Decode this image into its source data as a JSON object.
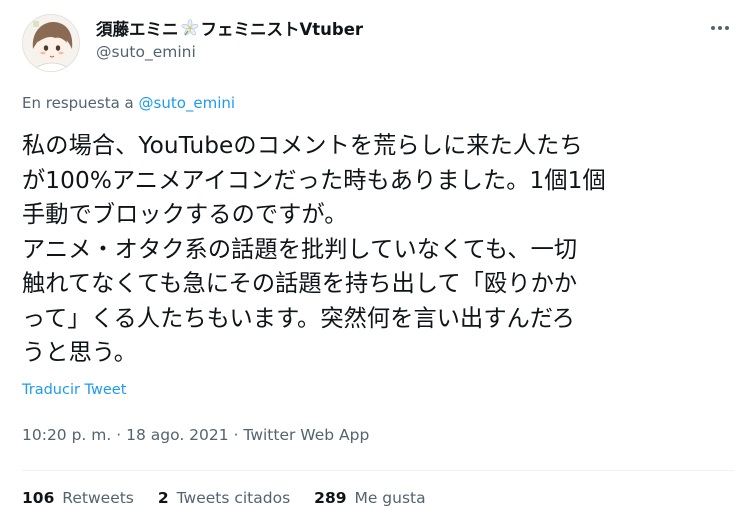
{
  "author": {
    "display_name_part1": "須藤エミニ",
    "flower_icon": "flower-emoji",
    "display_name_part2": "フェミニストVtuber",
    "handle": "@suto_emini",
    "avatar_icon": "anime-avatar"
  },
  "reply": {
    "prefix": "En respuesta a",
    "mention": "@suto_emini"
  },
  "tweet": {
    "lines": [
      "私の場合、YouTubeのコメントを荒らしに来た人たち",
      "が100%アニメアイコンだった時もありました。1個1個",
      "手動でブロックするのですが。",
      "アニメ・オタク系の話題を批判していなくても、一切",
      "触れてなくても急にその話題を持ち出して「殴りかか",
      "って」くる人たちもいます。突然何を言い出すんだろ",
      "うと思う。"
    ],
    "translate_label": "Traducir Tweet",
    "time": "10:20 p. m.",
    "separator": "·",
    "date": "18 ago. 2021",
    "app": "Twitter Web App"
  },
  "stats": {
    "retweets_count": "106",
    "retweets_label": "Retweets",
    "quotes_count": "2",
    "quotes_label": "Tweets citados",
    "likes_count": "289",
    "likes_label": "Me gusta"
  },
  "colors": {
    "link": "#1d9bf0",
    "secondary_text": "#536471",
    "primary_text": "#0f1419"
  }
}
